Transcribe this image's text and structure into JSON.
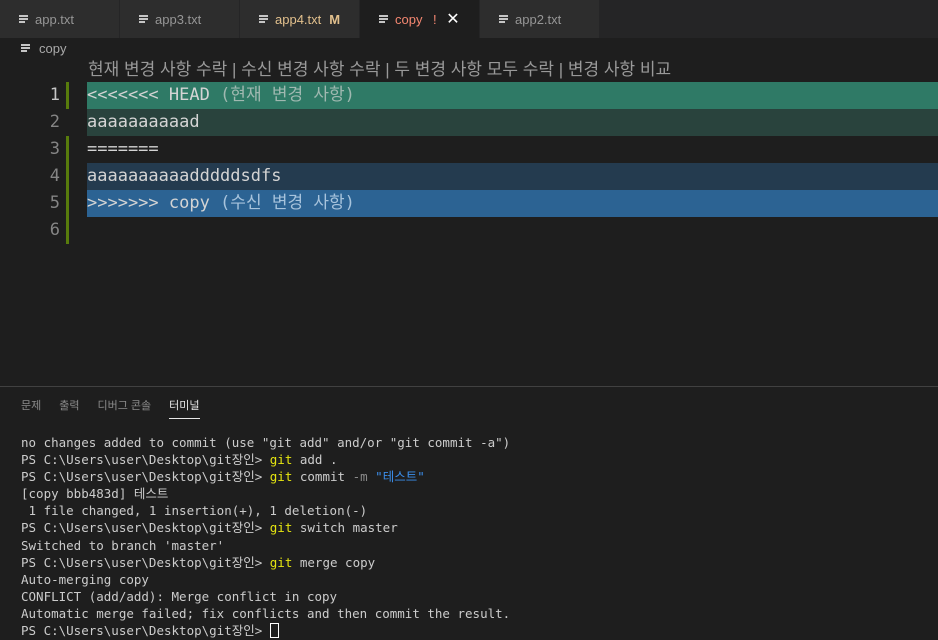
{
  "tabs": [
    {
      "label": "app.txt",
      "state": "normal"
    },
    {
      "label": "app3.txt",
      "state": "normal"
    },
    {
      "label": "app4.txt",
      "modified_badge": "M",
      "state": "modified"
    },
    {
      "label": "copy",
      "conflict_badge": "!",
      "state": "active"
    },
    {
      "label": "app2.txt",
      "state": "normal"
    }
  ],
  "breadcrumb": {
    "file": "copy"
  },
  "codelens": {
    "accept_current": "현재 변경 사항 수락",
    "accept_incoming": "수신 변경 사항 수락",
    "accept_both": "두 변경 사항 모두 수락",
    "compare": "변경 사항 비교",
    "separator": " | "
  },
  "editor": {
    "lines": [
      {
        "num": "1",
        "text": "<<<<<<< HEAD",
        "hint": " (현재 변경 사항)"
      },
      {
        "num": "2",
        "text": "aaaaaaaaaad"
      },
      {
        "num": "3",
        "text": "======="
      },
      {
        "num": "4",
        "text": "aaaaaaaaaadddddsdfs"
      },
      {
        "num": "5",
        "text": ">>>>>>> copy",
        "hint": " (수신 변경 사항)"
      },
      {
        "num": "6",
        "text": ""
      }
    ]
  },
  "panel": {
    "tabs": [
      "문제",
      "출력",
      "디버그 콘솔",
      "터미널"
    ],
    "active_tab": "터미널"
  },
  "terminal": {
    "l1": "no changes added to commit (use \"git add\" and/or \"git commit -a\")",
    "prompt": "PS C:\\Users\\user\\Desktop\\git장인> ",
    "git": "git",
    "add_args": " add .",
    "commit_sub": " commit ",
    "commit_flag": "-m",
    "commit_msg": " \"테스트\"",
    "l4": "[copy bbb483d] 테스트",
    "l5": " 1 file changed, 1 insertion(+), 1 deletion(-)",
    "switch_args": " switch master",
    "l7": "Switched to branch 'master'",
    "merge_args": " merge copy",
    "l9": "Auto-merging copy",
    "l10": "CONFLICT (add/add): Merge conflict in copy",
    "l11": "Automatic merge failed; fix conflicts and then commit the result."
  },
  "colors": {
    "current_header": "#2f7a66",
    "current_body": "#29433d",
    "incoming_body": "#243b4f",
    "incoming_header": "#2c6393"
  }
}
